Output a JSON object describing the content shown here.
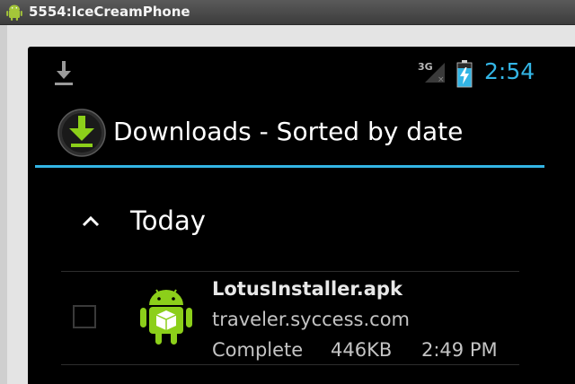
{
  "window": {
    "title": "5554:IceCreamPhone",
    "icon": "android-icon"
  },
  "status_bar": {
    "notification_icon": "download-icon",
    "signal_label": "3G",
    "signal_icon": "signal-strength-icon",
    "battery_icon": "battery-charging-icon",
    "clock": "2:54",
    "clock_color": "#33b5e5"
  },
  "action_bar": {
    "app_icon": "downloads-app-icon",
    "title": "Downloads - Sorted by date",
    "accent_color": "#33b5e5"
  },
  "downloads": {
    "group": {
      "label": "Today",
      "icon": "chevron-up-icon"
    },
    "items": [
      {
        "icon": "android-package-icon",
        "name": "LotusInstaller.apk",
        "source": "traveler.syccess.com",
        "status": "Complete",
        "size": "446KB",
        "time": "2:49 PM",
        "checked": false
      }
    ]
  }
}
